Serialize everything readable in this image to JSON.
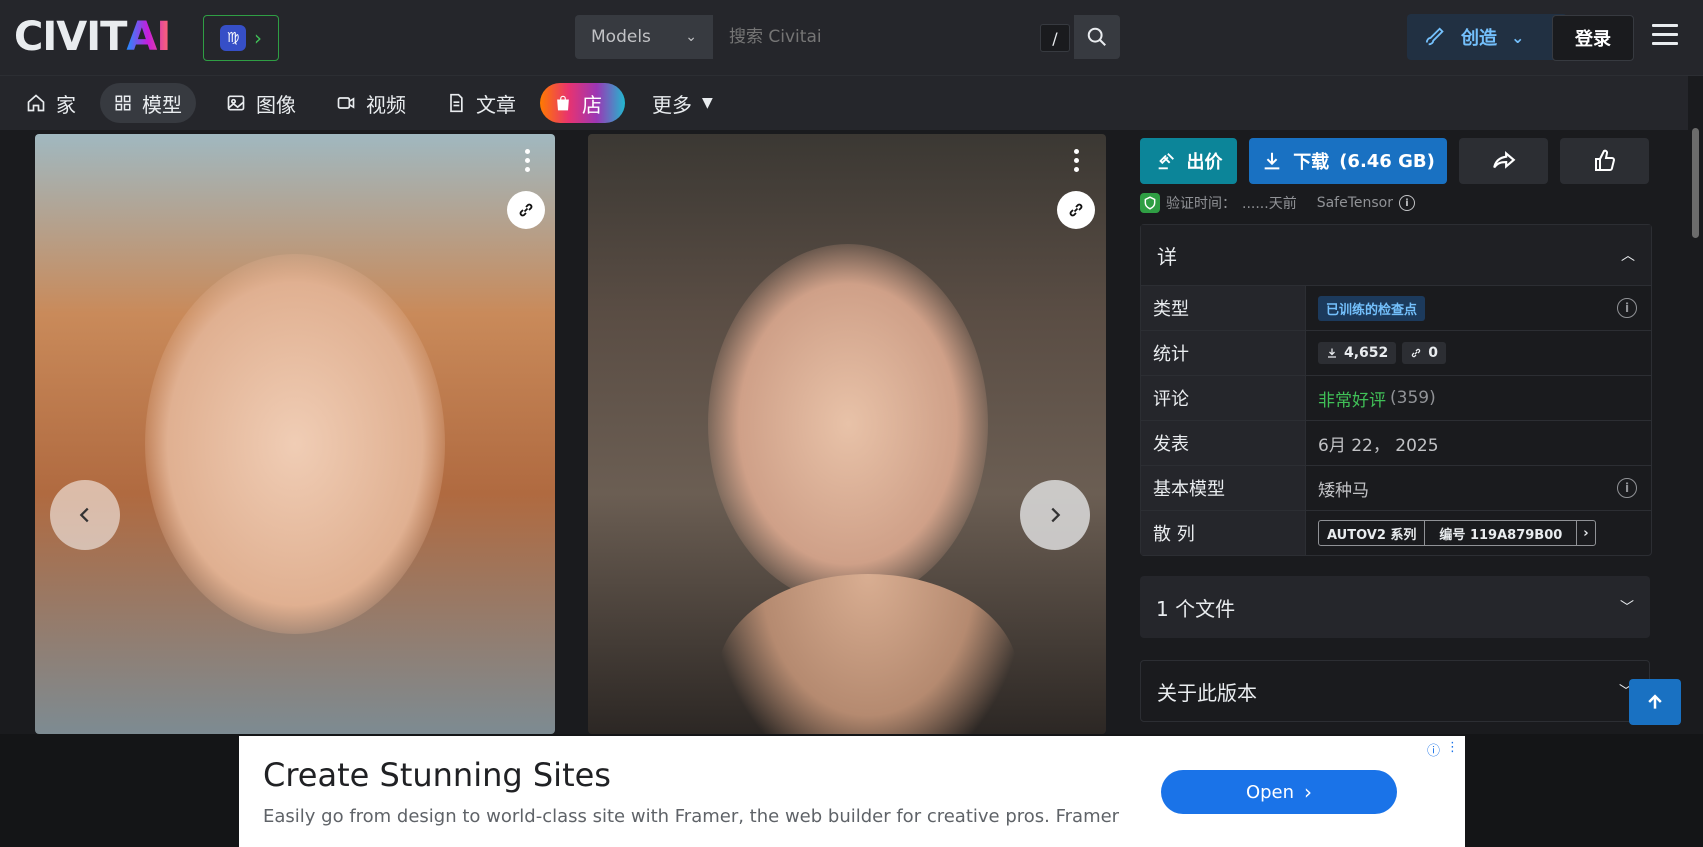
{
  "header": {
    "logo_text": "CIVIT",
    "logo_ai": "AI",
    "search_select": "Models",
    "search_placeholder": "搜索 Civitai",
    "search_shortcut": "/",
    "create_label": "创造",
    "login_label": "登录"
  },
  "nav": {
    "items": [
      {
        "label": "家",
        "icon": "home-icon"
      },
      {
        "label": "模型",
        "icon": "grid-icon"
      },
      {
        "label": "图像",
        "icon": "image-icon"
      },
      {
        "label": "视频",
        "icon": "video-icon"
      },
      {
        "label": "文章",
        "icon": "document-icon"
      },
      {
        "label": "店",
        "icon": "shopping-bag-icon"
      },
      {
        "label": "更多",
        "icon": "caret-down-icon"
      }
    ]
  },
  "actions": {
    "bid_label": "出价",
    "download_label": "下载",
    "download_size": "(6.46 GB)"
  },
  "verification": {
    "text": "验证时间：",
    "time": "......天前",
    "format": "SafeTensor"
  },
  "details": {
    "header": "详",
    "rows": {
      "type_label": "类型",
      "type_value": "已训练的检查点",
      "stats_label": "统计",
      "downloads": "4,652",
      "generations": "0",
      "reviews_label": "评论",
      "reviews_value": "非常好评",
      "reviews_count": "(359)",
      "published_label": "发表",
      "published_value": "6月 22， 2025",
      "base_model_label": "基本模型",
      "base_model_value": "矮种马",
      "series_label": "散 列",
      "series_type": "AUTOV2 系列",
      "series_hash": "编号 119A879B00"
    }
  },
  "files_section": {
    "label": "1 个文件"
  },
  "about_section": {
    "label": "关于此版本"
  },
  "ad": {
    "title": "Create Stunning Sites",
    "description": "Easily go from design to world-class site with Framer, the web builder for creative pros. Framer",
    "button_label": "Open"
  },
  "colors": {
    "accent_blue": "#1971c2",
    "accent_teal": "#0c8599",
    "positive_green": "#40c057"
  }
}
